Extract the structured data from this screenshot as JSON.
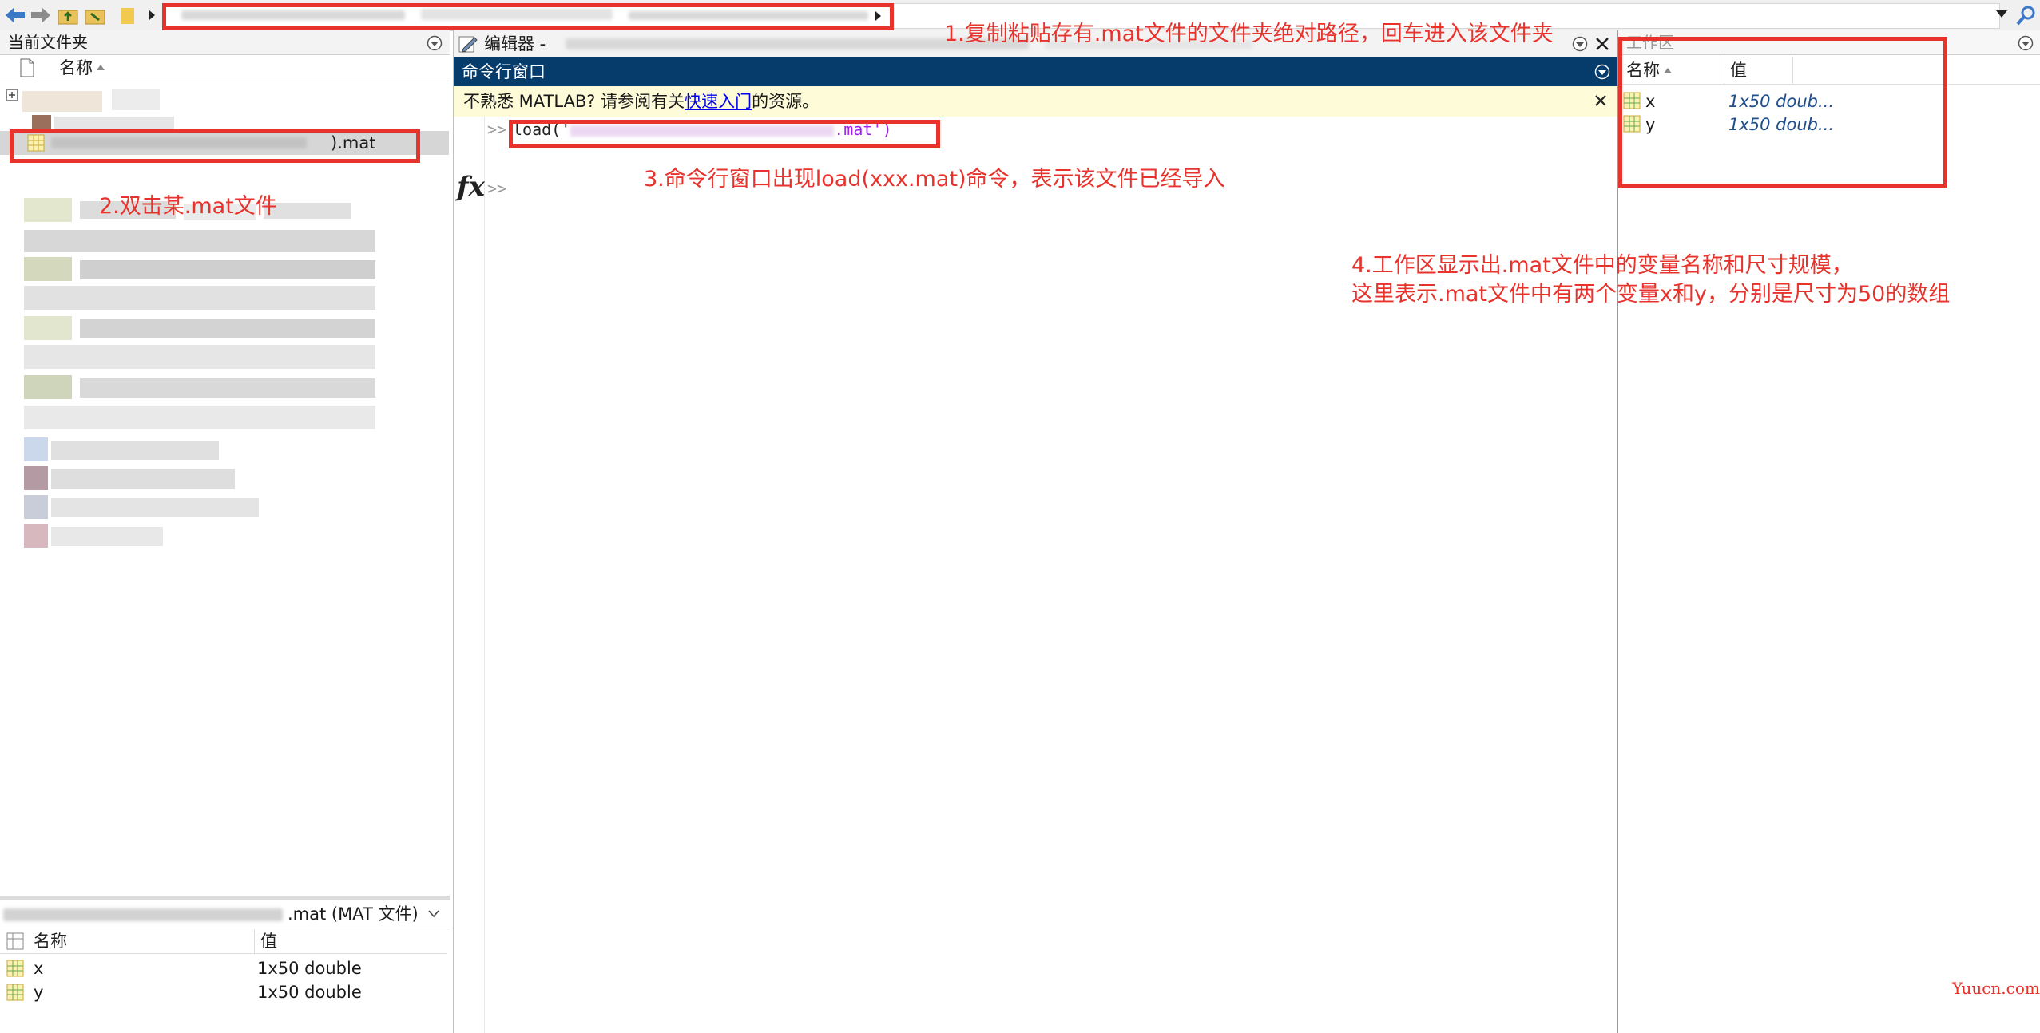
{
  "left_panel": {
    "title": "当前文件夹",
    "col_name": "名称",
    "selected_file_suffix": ").mat",
    "details_title": ".mat  (MAT 文件)",
    "details_cols": {
      "name": "名称",
      "value": "值"
    },
    "details_rows": [
      {
        "name": "x",
        "value": "1x50 double"
      },
      {
        "name": "y",
        "value": "1x50 double"
      }
    ]
  },
  "editor": {
    "tab_label": "编辑器 - "
  },
  "command_window": {
    "title": "命令行窗口",
    "banner_text": "不熟悉 MATLAB? 请参阅有关",
    "banner_link": "快速入门",
    "banner_suffix": "的资源。",
    "prompt": ">>",
    "cmd_prefix": "load('",
    "cmd_suffix": ".mat')",
    "fx_label": "fx"
  },
  "workspace": {
    "title": "工作区",
    "col_name": "名称",
    "col_value": "值",
    "vars": [
      {
        "name": "x",
        "value": "1x50 doub..."
      },
      {
        "name": "y",
        "value": "1x50 doub..."
      }
    ]
  },
  "annotations": {
    "step1": "1.复制粘贴存有.mat文件的文件夹绝对路径，回车进入该文件夹",
    "step2": "2.双击某.mat文件",
    "step3": "3.命令行窗口出现load(xxx.mat)命令，表示该文件已经导入",
    "step4_line1": "4.工作区显示出.mat文件中的变量名称和尺寸规模，",
    "step4_line2": "这里表示.mat文件中有两个变量x和y，分别是尺寸为50的数组"
  },
  "watermark": "Yuucn.com",
  "colors": {
    "annotation_red": "#e8322c",
    "cmd_title_bg": "#063c6c",
    "banner_bg": "#fdfbd8",
    "link_blue": "#0000ee"
  }
}
